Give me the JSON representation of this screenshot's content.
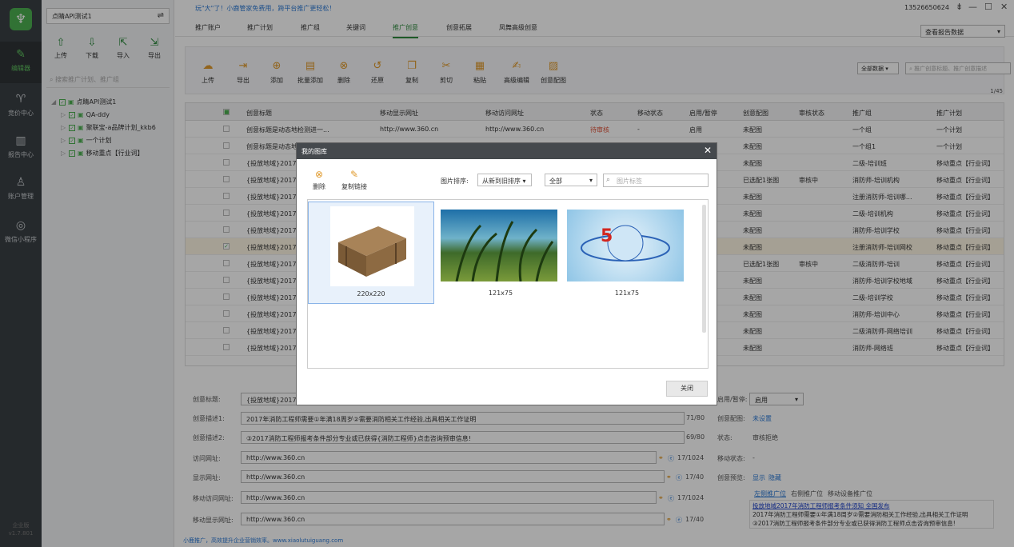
{
  "nav": {
    "items": [
      {
        "label": "编辑器",
        "icon": "edit-icon"
      },
      {
        "label": "竞价中心",
        "icon": "bid-icon"
      },
      {
        "label": "报告中心",
        "icon": "report-icon"
      },
      {
        "label": "账户管理",
        "icon": "account-icon"
      },
      {
        "label": "微信小程序",
        "icon": "wechat-icon"
      }
    ],
    "edition": "企业版",
    "version": "v1.7.801"
  },
  "sidebar": {
    "account": "点睛API测试1",
    "buttons": [
      {
        "label": "上传"
      },
      {
        "label": "下载"
      },
      {
        "label": "导入"
      },
      {
        "label": "导出"
      }
    ],
    "search_placeholder": "搜索推广计划、推广组",
    "tree": {
      "root": "点睛API测试1",
      "children": [
        "QA-ddy",
        "聚联宝-a品牌计划_kkb6",
        "一个计划",
        "移动重点【行业词】"
      ]
    }
  },
  "top": {
    "promo": "玩\"大\"了！小鹿管家免费用，跨平台推广更轻松！",
    "phone": "13526650624",
    "report_select": "查看报告数据"
  },
  "tabs": [
    "推广账户",
    "推广计划",
    "推广组",
    "关键词",
    "推广创意",
    "创意拓展",
    "凤舞高级创意"
  ],
  "toolbar": {
    "buttons": [
      "上传",
      "导出",
      "添加",
      "批量添加",
      "删除",
      "还原",
      "复制",
      "剪切",
      "粘贴",
      "高级编辑",
      "创意配图"
    ],
    "filter": "全部数据",
    "search_placeholder": "推广创意标题、推广创意描述",
    "pager": "1/45"
  },
  "grid": {
    "headers": [
      "创意标题",
      "移动显示网址",
      "移动访问网址",
      "状态",
      "移动状态",
      "启用/暂停",
      "创意配图",
      "审核状态",
      "推广组",
      "推广计划"
    ],
    "rows": [
      {
        "title": "创意标题是动态地检测进一...",
        "url": "http://www.360.cn",
        "murl": "http://www.360.cn",
        "status": "待审核",
        "mstatus": "-",
        "enable": "启用",
        "pic": "未配图",
        "audit": "",
        "group": "一个组",
        "plan": "一个计划"
      },
      {
        "title": "创意标题是动态地检测50",
        "url": "",
        "murl": "",
        "status": "",
        "mstatus": "",
        "enable": "",
        "pic": "未配图",
        "audit": "",
        "group": "一个组1",
        "plan": "一个计划"
      },
      {
        "title": "{投放地域}2017年",
        "url": "",
        "murl": "",
        "status": "",
        "mstatus": "",
        "enable": "",
        "pic": "未配图",
        "audit": "",
        "group": "二级-培训班",
        "plan": "移动重点【行业词】"
      },
      {
        "title": "{投放地域}2017年",
        "url": "",
        "murl": "",
        "status": "",
        "mstatus": "",
        "enable": "",
        "pic": "已选配1张图",
        "audit": "审核中",
        "group": "消防师-培训机构",
        "plan": "移动重点【行业词】"
      },
      {
        "title": "{投放地域}2017年",
        "url": "",
        "murl": "",
        "status": "",
        "mstatus": "",
        "enable": "",
        "pic": "未配图",
        "audit": "",
        "group": "注册消防师-培训哪...",
        "plan": "移动重点【行业词】"
      },
      {
        "title": "{投放地域}2017年",
        "url": "",
        "murl": "",
        "status": "",
        "mstatus": "",
        "enable": "",
        "pic": "未配图",
        "audit": "",
        "group": "二级-培训机构",
        "plan": "移动重点【行业词】"
      },
      {
        "title": "{投放地域}2017年",
        "url": "",
        "murl": "",
        "status": "",
        "mstatus": "",
        "enable": "",
        "pic": "未配图",
        "audit": "",
        "group": "消防师-培训学校",
        "plan": "移动重点【行业词】"
      },
      {
        "title": "{投放地域}2017年",
        "url": "",
        "murl": "",
        "status": "",
        "mstatus": "",
        "enable": "",
        "pic": "未配图",
        "audit": "",
        "group": "注册消防师-培训网校",
        "plan": "移动重点【行业词】",
        "selected": true
      },
      {
        "title": "{投放地域}2017年",
        "url": "",
        "murl": "",
        "status": "",
        "mstatus": "",
        "enable": "",
        "pic": "已选配1张图",
        "audit": "审核中",
        "group": "二级消防师-培训",
        "plan": "移动重点【行业词】"
      },
      {
        "title": "{投放地域}2017年",
        "url": "",
        "murl": "",
        "status": "",
        "mstatus": "",
        "enable": "",
        "pic": "未配图",
        "audit": "",
        "group": "消防师-培训学校地域",
        "plan": "移动重点【行业词】"
      },
      {
        "title": "{投放地域}2017年",
        "url": "",
        "murl": "",
        "status": "",
        "mstatus": "",
        "enable": "",
        "pic": "未配图",
        "audit": "",
        "group": "二级-培训学校",
        "plan": "移动重点【行业词】"
      },
      {
        "title": "{投放地域}2017年",
        "url": "",
        "murl": "",
        "status": "",
        "mstatus": "",
        "enable": "",
        "pic": "未配图",
        "audit": "",
        "group": "消防师-培训中心",
        "plan": "移动重点【行业词】"
      },
      {
        "title": "{投放地域}2017年",
        "url": "",
        "murl": "",
        "status": "",
        "mstatus": "",
        "enable": "",
        "pic": "未配图",
        "audit": "",
        "group": "二级消防师-网络培训",
        "plan": "移动重点【行业词】"
      },
      {
        "title": "{投放地域}2017年",
        "url": "",
        "murl": "",
        "status": "",
        "mstatus": "",
        "enable": "",
        "pic": "未配图",
        "audit": "",
        "group": "消防师-网络班",
        "plan": "移动重点【行业词】"
      }
    ]
  },
  "detail": {
    "title_label": "创意标题:",
    "title_value": "{投放地域}2017年",
    "desc1_label": "创意描述1:",
    "desc1_value": "2017年消防工程师需要①年满18周岁②需要消防相关工作经验,出具相关工作证明",
    "desc1_count": "71/80",
    "desc2_label": "创意描述2:",
    "desc2_value": "③2017消防工程师报考条件部分专业或已获得{消防工程师}点击咨询预审信息!",
    "desc2_count": "69/80",
    "visit_label": "访问网址:",
    "visit_value": "http://www.360.cn",
    "visit_count": "17/1024",
    "show_label": "显示网址:",
    "show_value": "http://www.360.cn",
    "show_count": "17/40",
    "mvisit_label": "移动访问网址:",
    "mvisit_value": "http://www.360.cn",
    "mvisit_count": "17/1024",
    "mshow_label": "移动显示网址:",
    "mshow_value": "http://www.360.cn",
    "mshow_count": "17/40",
    "enable_label": "启用/暂停:",
    "enable_value": "启用",
    "pic_label": "创意配图:",
    "pic_value": "未设置",
    "status_label": "状态:",
    "status_value": "审核拒绝",
    "mstatus_label": "移动状态:",
    "mstatus_value": "-",
    "preview_label": "创意预览:",
    "preview_show": "显示",
    "preview_hide": "隐藏",
    "preview_tabs": [
      "左侧推广位",
      "右侧推广位",
      "移动设备推广位"
    ],
    "preview_title": "投放地域2017年消防工程师报考条件须知 全国发布",
    "preview_l1": "2017年消防工程师需要①年满18周岁②需要消防相关工作经验,出具相关工作证明",
    "preview_l2": "③2017消防工程师报考条件部分专业或已获得消防工程师点击咨询预审信息!"
  },
  "footer": "小鹿推广，高效提升企业营销效率。www.xiaolutuiguang.com",
  "dialog": {
    "title": "我的图库",
    "delete": "删除",
    "copy_link": "复制链接",
    "sort_label": "图片排序:",
    "sort_value": "从新到旧排序",
    "filter_value": "全部",
    "search_placeholder": "图片标签",
    "images": [
      {
        "caption": "220x220"
      },
      {
        "caption": "121x75"
      },
      {
        "caption": "121x75"
      }
    ],
    "close": "关闭"
  }
}
